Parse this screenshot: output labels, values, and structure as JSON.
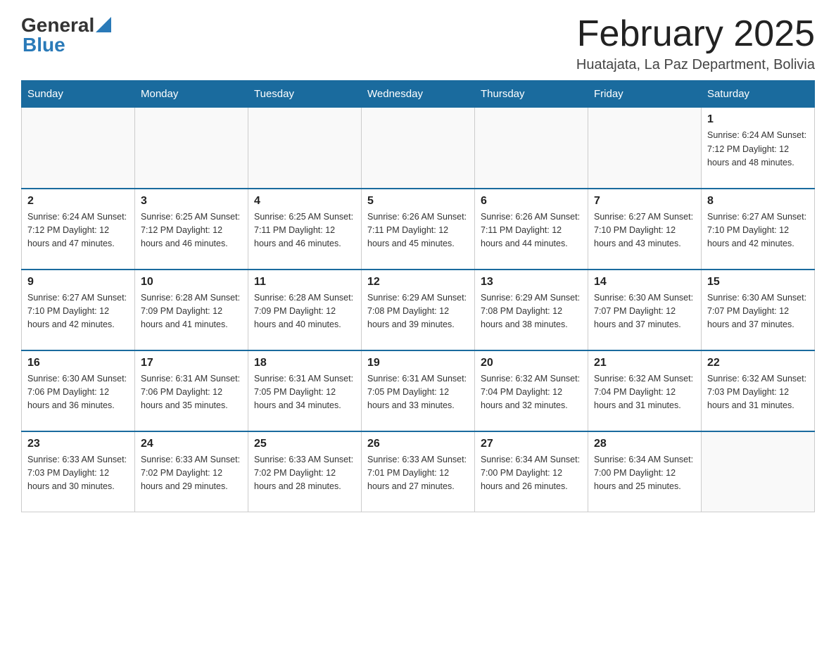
{
  "header": {
    "logo_general": "General",
    "logo_blue": "Blue",
    "month_title": "February 2025",
    "location": "Huatajata, La Paz Department, Bolivia"
  },
  "weekdays": [
    "Sunday",
    "Monday",
    "Tuesday",
    "Wednesday",
    "Thursday",
    "Friday",
    "Saturday"
  ],
  "weeks": [
    [
      {
        "day": "",
        "info": ""
      },
      {
        "day": "",
        "info": ""
      },
      {
        "day": "",
        "info": ""
      },
      {
        "day": "",
        "info": ""
      },
      {
        "day": "",
        "info": ""
      },
      {
        "day": "",
        "info": ""
      },
      {
        "day": "1",
        "info": "Sunrise: 6:24 AM\nSunset: 7:12 PM\nDaylight: 12 hours\nand 48 minutes."
      }
    ],
    [
      {
        "day": "2",
        "info": "Sunrise: 6:24 AM\nSunset: 7:12 PM\nDaylight: 12 hours\nand 47 minutes."
      },
      {
        "day": "3",
        "info": "Sunrise: 6:25 AM\nSunset: 7:12 PM\nDaylight: 12 hours\nand 46 minutes."
      },
      {
        "day": "4",
        "info": "Sunrise: 6:25 AM\nSunset: 7:11 PM\nDaylight: 12 hours\nand 46 minutes."
      },
      {
        "day": "5",
        "info": "Sunrise: 6:26 AM\nSunset: 7:11 PM\nDaylight: 12 hours\nand 45 minutes."
      },
      {
        "day": "6",
        "info": "Sunrise: 6:26 AM\nSunset: 7:11 PM\nDaylight: 12 hours\nand 44 minutes."
      },
      {
        "day": "7",
        "info": "Sunrise: 6:27 AM\nSunset: 7:10 PM\nDaylight: 12 hours\nand 43 minutes."
      },
      {
        "day": "8",
        "info": "Sunrise: 6:27 AM\nSunset: 7:10 PM\nDaylight: 12 hours\nand 42 minutes."
      }
    ],
    [
      {
        "day": "9",
        "info": "Sunrise: 6:27 AM\nSunset: 7:10 PM\nDaylight: 12 hours\nand 42 minutes."
      },
      {
        "day": "10",
        "info": "Sunrise: 6:28 AM\nSunset: 7:09 PM\nDaylight: 12 hours\nand 41 minutes."
      },
      {
        "day": "11",
        "info": "Sunrise: 6:28 AM\nSunset: 7:09 PM\nDaylight: 12 hours\nand 40 minutes."
      },
      {
        "day": "12",
        "info": "Sunrise: 6:29 AM\nSunset: 7:08 PM\nDaylight: 12 hours\nand 39 minutes."
      },
      {
        "day": "13",
        "info": "Sunrise: 6:29 AM\nSunset: 7:08 PM\nDaylight: 12 hours\nand 38 minutes."
      },
      {
        "day": "14",
        "info": "Sunrise: 6:30 AM\nSunset: 7:07 PM\nDaylight: 12 hours\nand 37 minutes."
      },
      {
        "day": "15",
        "info": "Sunrise: 6:30 AM\nSunset: 7:07 PM\nDaylight: 12 hours\nand 37 minutes."
      }
    ],
    [
      {
        "day": "16",
        "info": "Sunrise: 6:30 AM\nSunset: 7:06 PM\nDaylight: 12 hours\nand 36 minutes."
      },
      {
        "day": "17",
        "info": "Sunrise: 6:31 AM\nSunset: 7:06 PM\nDaylight: 12 hours\nand 35 minutes."
      },
      {
        "day": "18",
        "info": "Sunrise: 6:31 AM\nSunset: 7:05 PM\nDaylight: 12 hours\nand 34 minutes."
      },
      {
        "day": "19",
        "info": "Sunrise: 6:31 AM\nSunset: 7:05 PM\nDaylight: 12 hours\nand 33 minutes."
      },
      {
        "day": "20",
        "info": "Sunrise: 6:32 AM\nSunset: 7:04 PM\nDaylight: 12 hours\nand 32 minutes."
      },
      {
        "day": "21",
        "info": "Sunrise: 6:32 AM\nSunset: 7:04 PM\nDaylight: 12 hours\nand 31 minutes."
      },
      {
        "day": "22",
        "info": "Sunrise: 6:32 AM\nSunset: 7:03 PM\nDaylight: 12 hours\nand 31 minutes."
      }
    ],
    [
      {
        "day": "23",
        "info": "Sunrise: 6:33 AM\nSunset: 7:03 PM\nDaylight: 12 hours\nand 30 minutes."
      },
      {
        "day": "24",
        "info": "Sunrise: 6:33 AM\nSunset: 7:02 PM\nDaylight: 12 hours\nand 29 minutes."
      },
      {
        "day": "25",
        "info": "Sunrise: 6:33 AM\nSunset: 7:02 PM\nDaylight: 12 hours\nand 28 minutes."
      },
      {
        "day": "26",
        "info": "Sunrise: 6:33 AM\nSunset: 7:01 PM\nDaylight: 12 hours\nand 27 minutes."
      },
      {
        "day": "27",
        "info": "Sunrise: 6:34 AM\nSunset: 7:00 PM\nDaylight: 12 hours\nand 26 minutes."
      },
      {
        "day": "28",
        "info": "Sunrise: 6:34 AM\nSunset: 7:00 PM\nDaylight: 12 hours\nand 25 minutes."
      },
      {
        "day": "",
        "info": ""
      }
    ]
  ]
}
